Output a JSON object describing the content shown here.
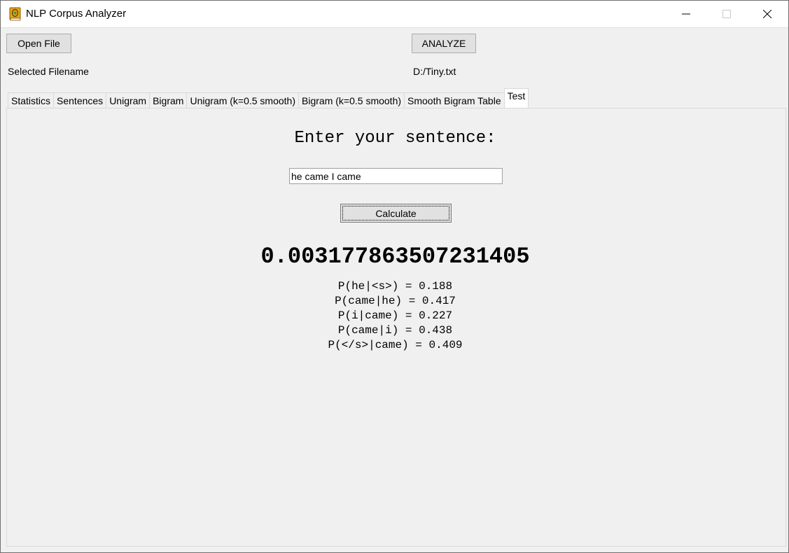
{
  "window": {
    "title": "NLP Corpus Analyzer",
    "icon": "book-icon",
    "controls": [
      "minimize",
      "maximize",
      "close"
    ]
  },
  "toolbar": {
    "open_file_label": "Open File",
    "analyze_label": "ANALYZE",
    "selected_filename_label": "Selected Filename",
    "selected_filename_value": "D:/Tiny.txt"
  },
  "tabs": [
    {
      "label": "Statistics",
      "active": false
    },
    {
      "label": "Sentences",
      "active": false
    },
    {
      "label": "Unigram",
      "active": false
    },
    {
      "label": "Bigram",
      "active": false
    },
    {
      "label": "Unigram (k=0.5 smooth)",
      "active": false
    },
    {
      "label": "Bigram (k=0.5 smooth)",
      "active": false
    },
    {
      "label": "Smooth Bigram Table",
      "active": false
    },
    {
      "label": "Test",
      "active": true
    }
  ],
  "test": {
    "prompt": "Enter your sentence:",
    "sentence_value": "he came I came",
    "calculate_label": "Calculate",
    "result": "0.003177863507231405",
    "probabilities": [
      "P(he|<s>) = 0.188",
      "P(came|he) = 0.417",
      "P(i|came) = 0.227",
      "P(came|i) = 0.438",
      "P(</s>|came) = 0.409"
    ]
  }
}
